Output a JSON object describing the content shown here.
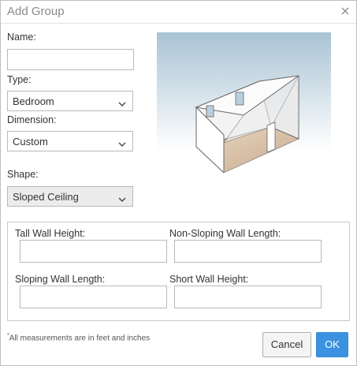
{
  "dialog": {
    "title": "Add Group",
    "close_icon": "close-icon"
  },
  "form": {
    "name_label": "Name:",
    "name_value": "",
    "type_label": "Type:",
    "type_value": "Bedroom",
    "dimension_label": "Dimension:",
    "dimension_value": "Custom",
    "shape_label": "Shape:",
    "shape_value": "Sloped Ceiling"
  },
  "illustration": {
    "description_icon": "sloped-ceiling-room-illustration"
  },
  "measurements": {
    "tall_wall_height_label": "Tall Wall Height:",
    "tall_wall_height_value": "",
    "non_sloping_wall_length_label": "Non-Sloping Wall Length:",
    "non_sloping_wall_length_value": "",
    "sloping_wall_length_label": "Sloping Wall Length:",
    "sloping_wall_length_value": "",
    "short_wall_height_label": "Short Wall Height:",
    "short_wall_height_value": ""
  },
  "footer": {
    "note_marker": "*",
    "note_text": "All measurements are in feet and inches",
    "cancel_label": "Cancel",
    "ok_label": "OK"
  },
  "colors": {
    "primary_button": "#3b92e0",
    "title_text": "#8a8a8a"
  }
}
